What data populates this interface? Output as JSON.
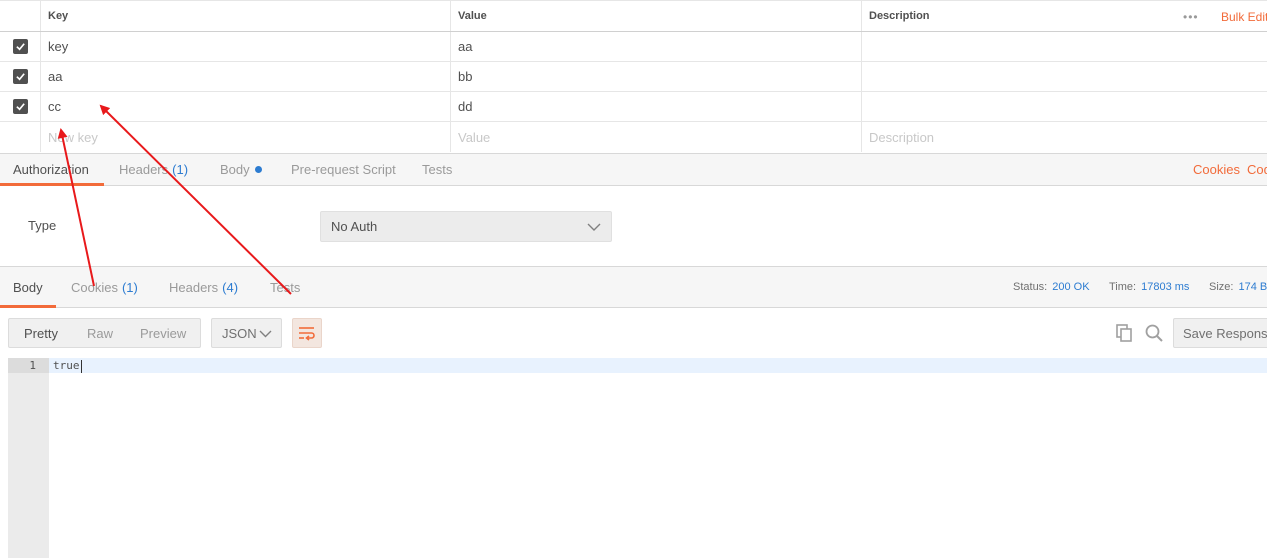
{
  "params": {
    "headers": {
      "key": "Key",
      "value": "Value",
      "description": "Description"
    },
    "bulk_dots": "•••",
    "bulk_edit": "Bulk Edit",
    "rows": [
      {
        "key": "key",
        "value": "aa",
        "description": ""
      },
      {
        "key": "aa",
        "value": "bb",
        "description": ""
      },
      {
        "key": "cc",
        "value": "dd",
        "description": ""
      }
    ],
    "new_row": {
      "key_placeholder": "New key",
      "value_placeholder": "Value",
      "description_placeholder": "Description"
    }
  },
  "request_tabs": {
    "authorization": "Authorization",
    "headers": "Headers",
    "headers_count": "(1)",
    "body": "Body",
    "prerequest": "Pre-request Script",
    "tests": "Tests",
    "cookies_link": "Cookies",
    "code_link": "Code"
  },
  "auth": {
    "type_label": "Type",
    "selected": "No Auth"
  },
  "response_tabs": {
    "body": "Body",
    "cookies": "Cookies",
    "cookies_count": "(1)",
    "headers": "Headers",
    "headers_count": "(4)",
    "tests": "Tests",
    "status_label": "Status:",
    "status_value": "200 OK",
    "time_label": "Time:",
    "time_value": "17803 ms",
    "size_label": "Size:",
    "size_value": "174 B"
  },
  "toolbar": {
    "pretty": "Pretty",
    "raw": "Raw",
    "preview": "Preview",
    "format": "JSON",
    "save_response": "Save Response"
  },
  "editor": {
    "line_number": "1",
    "content": "true"
  },
  "colors": {
    "accent": "#f26b3a",
    "link": "#2d7cd1",
    "annotation": "#e8191b"
  }
}
